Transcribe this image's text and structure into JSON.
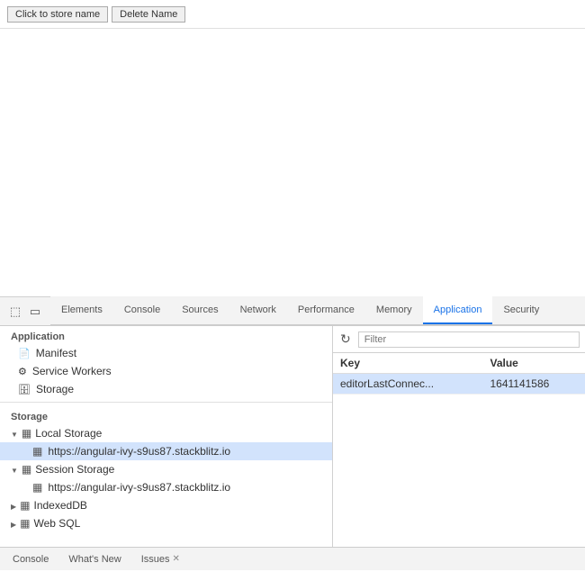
{
  "topBar": {
    "btn1": "Click to store name",
    "btn2": "Delete Name"
  },
  "devtools": {
    "tabs": [
      {
        "id": "elements",
        "label": "Elements",
        "active": false
      },
      {
        "id": "console",
        "label": "Console",
        "active": false
      },
      {
        "id": "sources",
        "label": "Sources",
        "active": false
      },
      {
        "id": "network",
        "label": "Network",
        "active": false
      },
      {
        "id": "performance",
        "label": "Performance",
        "active": false
      },
      {
        "id": "memory",
        "label": "Memory",
        "active": false
      },
      {
        "id": "application",
        "label": "Application",
        "active": true
      },
      {
        "id": "security",
        "label": "Security",
        "active": false
      }
    ],
    "sidebar": {
      "sections": [
        {
          "header": "Application",
          "items": [
            {
              "id": "manifest",
              "label": "Manifest",
              "icon": "manifest",
              "indent": 1
            },
            {
              "id": "service-workers",
              "label": "Service Workers",
              "icon": "gear",
              "indent": 1
            },
            {
              "id": "storage",
              "label": "Storage",
              "icon": "db",
              "indent": 1
            }
          ]
        },
        {
          "header": "Storage",
          "items": [
            {
              "id": "local-storage-group",
              "label": "Local Storage",
              "icon": "table",
              "type": "group",
              "expanded": true
            },
            {
              "id": "local-storage-url",
              "label": "https://angular-ivy-s9us87.stackblitz.io",
              "icon": "table",
              "type": "sub",
              "selected": true
            },
            {
              "id": "session-storage-group",
              "label": "Session Storage",
              "icon": "table",
              "type": "group",
              "expanded": true
            },
            {
              "id": "session-storage-url",
              "label": "https://angular-ivy-s9us87.stackblitz.io",
              "icon": "table",
              "type": "sub"
            },
            {
              "id": "indexeddb",
              "label": "IndexedDB",
              "icon": "table",
              "type": "group",
              "expanded": false
            },
            {
              "id": "websql",
              "label": "Web SQL",
              "icon": "table",
              "type": "group",
              "expanded": false
            }
          ]
        }
      ]
    },
    "mainPanel": {
      "filterPlaceholder": "Filter",
      "columns": [
        "Key",
        "Value"
      ],
      "rows": [
        {
          "key": "editorLastConnec...",
          "value": "1641141586",
          "selected": true
        }
      ]
    },
    "bottomTabs": [
      {
        "label": "Console",
        "closable": false
      },
      {
        "label": "What's New",
        "closable": false
      },
      {
        "label": "Issues",
        "closable": true
      }
    ]
  }
}
